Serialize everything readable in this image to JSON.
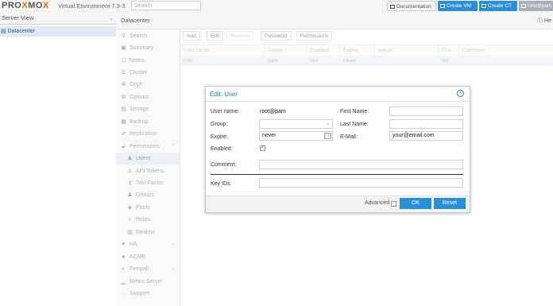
{
  "topbar": {
    "logo_prefix": "PRO",
    "logo_x1": "X",
    "logo_mid": "MO",
    "logo_x2": "X",
    "version": "Virtual Environment 7.3-3",
    "search_placeholder": "Search",
    "documentation_label": "Documentation",
    "create_vm_label": "Create VM",
    "create_ct_label": "Create CT",
    "user_label": "root@pam"
  },
  "tree": {
    "view_label": "Server View",
    "items": [
      {
        "label": "Datacenter"
      }
    ]
  },
  "header": {
    "title": "Datacenter",
    "help_label": "He"
  },
  "nav": {
    "items": [
      {
        "label": "Search",
        "icon": "search-icon"
      },
      {
        "label": "Summary",
        "icon": "book-icon"
      },
      {
        "label": "Notes",
        "icon": "notes-icon"
      },
      {
        "label": "Cluster",
        "icon": "server-icon"
      },
      {
        "label": "Ceph",
        "icon": "ceph-icon"
      },
      {
        "label": "Options",
        "icon": "gear-icon"
      },
      {
        "label": "Storage",
        "icon": "database-icon"
      },
      {
        "label": "Backup",
        "icon": "floppy-icon"
      },
      {
        "label": "Replication",
        "icon": "retweet-icon"
      },
      {
        "label": "Permissions",
        "icon": "unlock-icon"
      },
      {
        "label": "Users",
        "icon": "user-icon"
      },
      {
        "label": "API Tokens",
        "icon": "user-outline-icon"
      },
      {
        "label": "Two Factor",
        "icon": "key-icon"
      },
      {
        "label": "Groups",
        "icon": "users-icon"
      },
      {
        "label": "Pools",
        "icon": "tags-icon"
      },
      {
        "label": "Roles",
        "icon": "male-icon"
      },
      {
        "label": "Realms",
        "icon": "address-book-icon"
      },
      {
        "label": "HA",
        "icon": "heartbeat-icon"
      },
      {
        "label": "ACME",
        "icon": "certificate-icon"
      },
      {
        "label": "Firewall",
        "icon": "shield-icon"
      },
      {
        "label": "Metric Server",
        "icon": "bar-chart-icon"
      },
      {
        "label": "Support",
        "icon": "comments-icon"
      }
    ]
  },
  "toolbar": {
    "add_label": "Add",
    "edit_label": "Edit",
    "remove_label": "Remove",
    "password_label": "Password",
    "permissions_label": "Permissions"
  },
  "grid": {
    "columns": [
      "User name ↑",
      "Realm ↑",
      "Enabled",
      "Expire",
      "Name",
      "TFA",
      "Comment"
    ],
    "rows": [
      {
        "username": "root",
        "realm": "pam",
        "enabled": "Yes",
        "expire": "never",
        "name": "",
        "tfa": "No",
        "comment": ""
      }
    ]
  },
  "dialog": {
    "title": "Edit: User",
    "username_label": "User name:",
    "username_value": "root@pam",
    "group_label": "Group:",
    "group_value": "",
    "expire_label": "Expire:",
    "expire_value": "never",
    "enabled_label": "Enabled:",
    "enabled_checked": true,
    "firstname_label": "First Name:",
    "firstname_value": "",
    "lastname_label": "Last Name:",
    "lastname_value": "",
    "email_label": "E-Mail:",
    "email_value": "your@email.com",
    "comment_label": "Comment:",
    "comment_value": "",
    "keyids_label": "Key IDs:",
    "keyids_value": "",
    "advanced_label": "Advanced",
    "ok_label": "OK",
    "reset_label": "Reset"
  },
  "colors": {
    "accent": "#2a8fd6",
    "logo_x": "#e57000",
    "selected_bg": "#dbe5f0"
  }
}
